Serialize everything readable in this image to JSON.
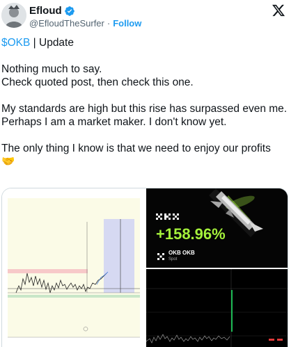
{
  "author": {
    "display_name": "Efloud",
    "handle": "@EfloudTheSurfer",
    "separator": "·",
    "follow_label": "Follow",
    "verified": true
  },
  "tweet": {
    "cashtag": "$OKB",
    "update_text": " | Update",
    "line1": "Nothing much to say.",
    "line2": "Check quoted post, then check this one.",
    "line3": "My standards are high but this rise has surpassed even me.",
    "line4": "Perhaps I am a market maker. I don't know yet.",
    "line5": "The only thing I know is that we need to enjoy our profits",
    "emoji": "🤝"
  },
  "media": {
    "okx_card": {
      "percent": "+158.96%",
      "coin_name": "OKB OKB",
      "market": "Spot"
    }
  },
  "colors": {
    "accent": "#1d9bf0",
    "okx_green": "#a5f23b"
  },
  "icons": {
    "brand": "x-logo-icon",
    "badge": "verified-badge-icon"
  }
}
